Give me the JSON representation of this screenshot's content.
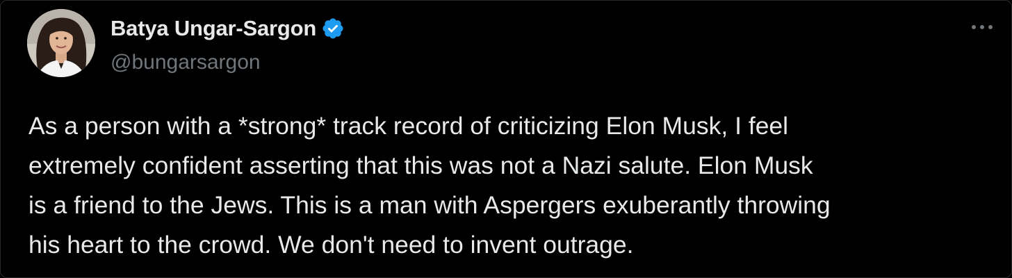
{
  "author": {
    "display_name": "Batya Ungar-Sargon",
    "handle": "@bungarsargon",
    "verified": true,
    "verified_color": "#1d9bf0"
  },
  "menu": {
    "icon": "more-horizontal-icon"
  },
  "tweet": {
    "lines": [
      "As a person with a *strong* track record of criticizing Elon Musk, I feel",
      "extremely confident asserting that this was not a Nazi salute. Elon Musk",
      "is a friend to the Jews. This is a man with Aspergers exuberantly throwing",
      "his heart to the crowd. We don't need to invent outrage."
    ]
  },
  "colors": {
    "background": "#000000",
    "primary_text": "#e7e9ea",
    "secondary_text": "#71767b"
  }
}
